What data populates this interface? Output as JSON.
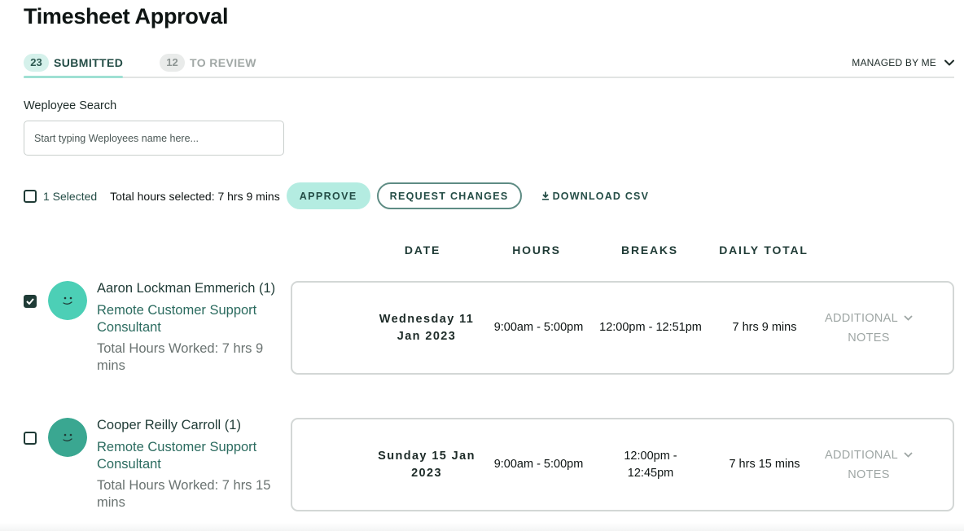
{
  "page": {
    "title": "Timesheet Approval"
  },
  "tabs": [
    {
      "count": "23",
      "label": "SUBMITTED",
      "active": true
    },
    {
      "count": "12",
      "label": "TO REVIEW",
      "active": false
    }
  ],
  "filter": {
    "label": "MANAGED BY ME"
  },
  "search": {
    "label": "Weployee Search",
    "placeholder": "Start typing Weployees name here..."
  },
  "toolbar": {
    "selected_label": "1 Selected",
    "total_hours": "Total hours selected: 7 hrs 9 mins",
    "approve_label": "APPROVE",
    "request_changes_label": "REQUEST CHANGES",
    "download_label": "DOWNLOAD CSV"
  },
  "columns": [
    "DATE",
    "HOURS",
    "BREAKS",
    "DAILY TOTAL"
  ],
  "rows": [
    {
      "checked": true,
      "name": "Aaron Lockman Emmerich (1)",
      "role": "Remote Customer Support Consultant",
      "total_hours": "Total Hours Worked: 7 hrs 9 mins",
      "date": "Wednesday 11 Jan 2023",
      "hours": "9:00am - 5:00pm",
      "breaks": "12:00pm - 12:51pm",
      "daily_total": "7 hrs 9 mins",
      "notes_line1": "ADDITIONAL",
      "notes_line2": "NOTES",
      "avatar_color": "#4ccfb6"
    },
    {
      "checked": false,
      "name": "Cooper Reilly Carroll (1)",
      "role": "Remote Customer Support Consultant",
      "total_hours": "Total Hours Worked: 7 hrs 15 mins",
      "date": "Sunday 15 Jan 2023",
      "hours": "9:00am - 5:00pm",
      "breaks": "12:00pm - 12:45pm",
      "daily_total": "7 hrs 15 mins",
      "notes_line1": "ADDITIONAL",
      "notes_line2": "NOTES",
      "avatar_color": "#3aa791"
    }
  ],
  "colors": {
    "accent": "#b4ece1",
    "primary_dark": "#1f3b36",
    "role_text": "#2b6b5f"
  }
}
